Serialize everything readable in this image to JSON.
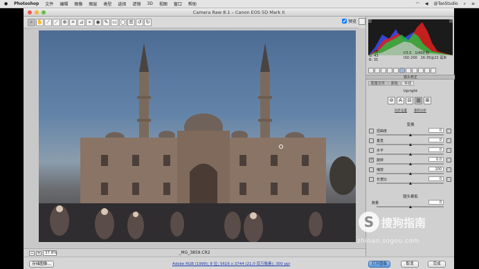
{
  "menubar": {
    "app": "Photoshop",
    "items": [
      "文件",
      "编辑",
      "图像",
      "图层",
      "类型",
      "选择",
      "滤镜",
      "3D",
      "视图",
      "窗口",
      "帮助"
    ],
    "user": "@TaoStudio"
  },
  "window": {
    "title": "Camera Raw 8.1  –  Canon EOS 5D Mark II"
  },
  "toolbar": {
    "tools": [
      "zoom-tool",
      "hand-tool",
      "white-balance-tool",
      "color-sampler-tool",
      "targeted-adjustment-tool",
      "crop-tool",
      "straighten-tool",
      "spot-removal-tool",
      "red-eye-tool",
      "adjustment-brush-tool",
      "graduated-filter-tool",
      "radial-filter-tool",
      "preferences",
      "rotate-left",
      "rotate-right"
    ],
    "preview_label": "预览",
    "preview_checked": true
  },
  "image": {
    "zoom": "37.8%",
    "filename": "_MG_3859.CR2"
  },
  "readout": {
    "r": "R: 58",
    "g": "G: 43",
    "b": "B: 35",
    "aperture": "f/3.5",
    "shutter": "1/400 秒",
    "iso": "ISO 200",
    "lens": "16-35@22 毫米"
  },
  "panel": {
    "section_title": "镜头校正",
    "tabs": [
      "配置文件",
      "颜色",
      "手动"
    ],
    "upright_title": "Upright",
    "upright_links": [
      "同步设置",
      "重新分析"
    ],
    "transform_title": "变换",
    "sliders": [
      {
        "label": "扭曲度",
        "value": "0"
      },
      {
        "label": "垂直",
        "value": "0"
      },
      {
        "label": "水平",
        "value": "0"
      },
      {
        "label": "旋转",
        "value": "0.0"
      },
      {
        "label": "缩放",
        "value": "100"
      },
      {
        "label": "长宽比",
        "value": "0"
      }
    ],
    "vignette_title": "镜头晕影",
    "vignette_slider": {
      "label": "数量",
      "value": "0"
    }
  },
  "footer": {
    "save_label": "存储图像...",
    "workflow": "Adobe RGB (1998); 8 位; 5616 x 3744 (21.0 百万像素); 300 ppi",
    "open_label": "打开图像",
    "cancel_label": "取消",
    "done_label": "完成"
  },
  "watermark": {
    "brand": "搜狗指南",
    "url": "zhinan.sogou.com"
  },
  "colors": {
    "accent": "#5b98da",
    "histogram_bg": "#1b1b1b",
    "sky": "#4d6c95"
  }
}
